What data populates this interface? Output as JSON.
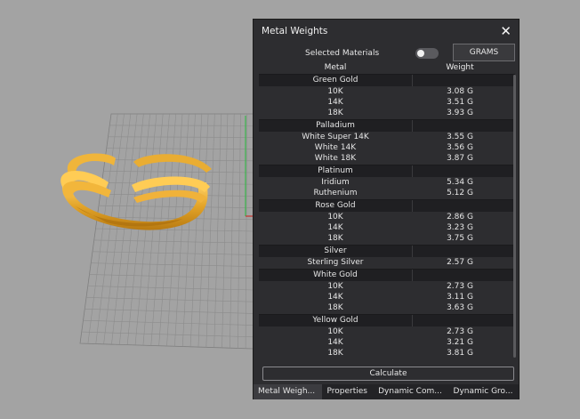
{
  "panel": {
    "title": "Metal Weights",
    "selected_materials_label": "Selected Materials",
    "units_button": "GRAMS",
    "calculate_label": "Calculate",
    "columns": {
      "metal": "Metal",
      "weight": "Weight"
    },
    "groups": [
      {
        "name": "Green Gold",
        "items": [
          {
            "metal": "10K",
            "weight": "3.08 G"
          },
          {
            "metal": "14K",
            "weight": "3.51 G"
          },
          {
            "metal": "18K",
            "weight": "3.93 G"
          }
        ]
      },
      {
        "name": "Palladium",
        "items": [
          {
            "metal": "White Super 14K",
            "weight": "3.55 G"
          },
          {
            "metal": "White 14K",
            "weight": "3.56 G"
          },
          {
            "metal": "White 18K",
            "weight": "3.87 G"
          }
        ]
      },
      {
        "name": "Platinum",
        "items": [
          {
            "metal": "Iridium",
            "weight": "5.34 G"
          },
          {
            "metal": "Ruthenium",
            "weight": "5.12 G"
          }
        ]
      },
      {
        "name": "Rose Gold",
        "items": [
          {
            "metal": "10K",
            "weight": "2.86 G"
          },
          {
            "metal": "14K",
            "weight": "3.23 G"
          },
          {
            "metal": "18K",
            "weight": "3.75 G"
          }
        ]
      },
      {
        "name": "Silver",
        "items": [
          {
            "metal": "Sterling Silver",
            "weight": "2.57 G"
          }
        ]
      },
      {
        "name": "White Gold",
        "items": [
          {
            "metal": "10K",
            "weight": "2.73 G"
          },
          {
            "metal": "14K",
            "weight": "3.11 G"
          },
          {
            "metal": "18K",
            "weight": "3.63 G"
          }
        ]
      },
      {
        "name": "Yellow Gold",
        "items": [
          {
            "metal": "10K",
            "weight": "2.73 G"
          },
          {
            "metal": "14K",
            "weight": "3.21 G"
          },
          {
            "metal": "18K",
            "weight": "3.81 G"
          }
        ]
      }
    ],
    "tabs": [
      {
        "label": "Metal Weigh...",
        "active": true
      },
      {
        "label": "Properties",
        "active": false
      },
      {
        "label": "Dynamic Com...",
        "active": false
      },
      {
        "label": "Dynamic Gro...",
        "active": false
      }
    ]
  },
  "colors": {
    "viewport_bg": "#a3a3a3",
    "panel_bg": "#2d2d30",
    "ring_gold": "#e0a52a"
  }
}
